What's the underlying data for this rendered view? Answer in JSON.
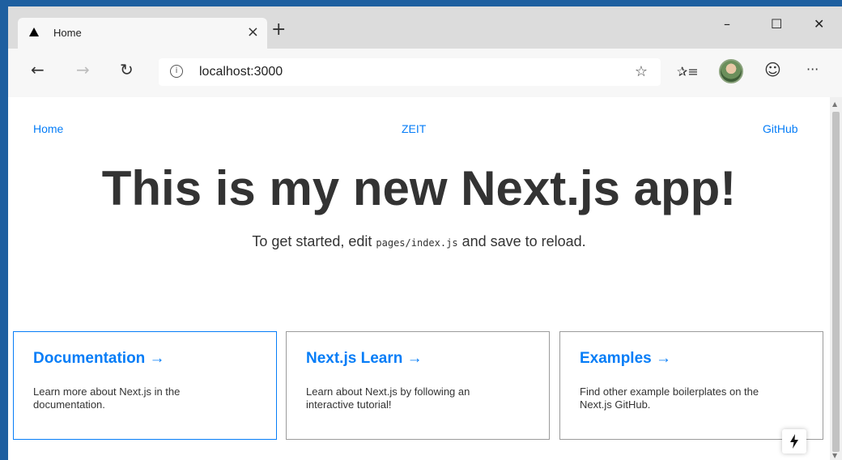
{
  "browser": {
    "tab": {
      "title": "Home",
      "favicon": "triangle-icon",
      "close": "×"
    },
    "new_tab": "+",
    "window_controls": {
      "minimize": "–",
      "maximize": "☐",
      "close": "✕"
    },
    "toolbar": {
      "back": "←",
      "forward": "→",
      "refresh": "↻",
      "address": "localhost:3000",
      "info_icon": "i",
      "star": "☆",
      "favorites": "✰≡",
      "emoji": "☺",
      "menu": "···"
    }
  },
  "page": {
    "nav": {
      "home": "Home",
      "zeit": "ZEIT",
      "github": "GitHub"
    },
    "title": "This is my new Next.js app!",
    "subtitle": {
      "before": "To get started, edit ",
      "code": "pages/index.js",
      "after": " and save to reload."
    },
    "cards": [
      {
        "title": "Documentation →",
        "description": "Learn more about Next.js in the documentation."
      },
      {
        "title": "Next.js Learn →",
        "description": "Learn about Next.js by following an interactive tutorial!"
      },
      {
        "title": "Examples →",
        "description": "Find other example boilerplates on the Next.js GitHub."
      }
    ],
    "bolt_icon": "lightning-icon"
  },
  "colors": {
    "link": "#067df7",
    "text": "#333333",
    "window_accent": "#1e5fa0"
  }
}
